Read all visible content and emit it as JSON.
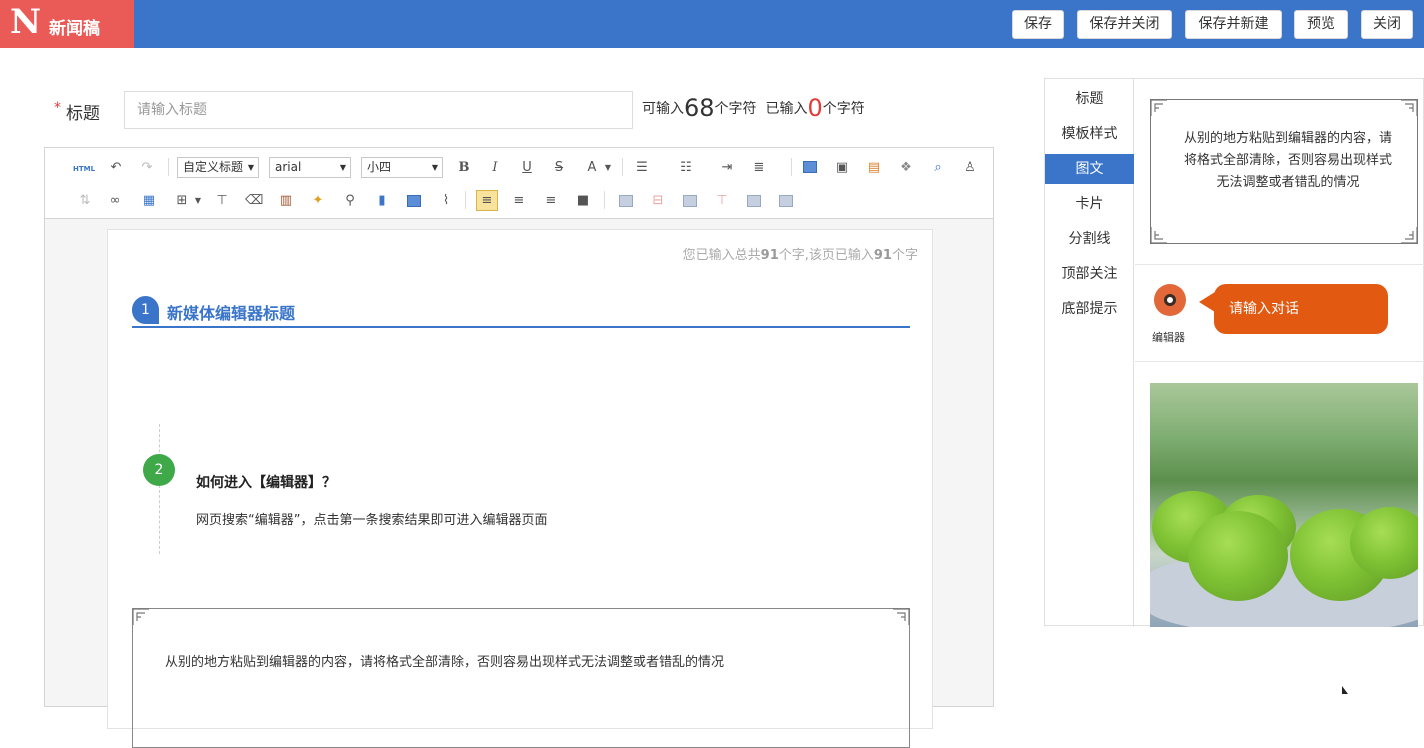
{
  "header": {
    "logo_letter": "N",
    "title": "新闻稿",
    "buttons": [
      "保存",
      "保存并关闭",
      "保存并新建",
      "预览",
      "关闭"
    ]
  },
  "title_row": {
    "required_mark": "*",
    "label": "标题",
    "placeholder": "请输入标题",
    "can_input_prefix": "可输入",
    "can_input_count": "68",
    "char_unit_1": "个字符",
    "entered_prefix": "已输入",
    "entered_count": "0",
    "char_unit_2": "个字符"
  },
  "toolbar": {
    "html_label": "HTML",
    "heading_select": "自定义标题",
    "font_select": "arial",
    "size_select": "小四",
    "bold": "B",
    "italic": "I",
    "underline": "U",
    "strike": "S",
    "font_color": "A"
  },
  "page": {
    "word_count_prefix": "您已输入总共",
    "total_count": "91",
    "word_count_mid": "个字,该页已输入",
    "page_count": "91",
    "word_count_suffix": "个字",
    "heading_number": "1",
    "heading_text": "新媒体编辑器标题",
    "step_number": "2",
    "question": "如何进入【编辑器】？",
    "answer": "网页搜索“编辑器”，点击第一条搜索结果即可进入编辑器页面",
    "frame_text": "从别的地方粘贴到编辑器的内容，请将格式全部清除，否则容易出现样式无法调整或者错乱的情况"
  },
  "right_panel": {
    "nav": [
      "标题",
      "模板样式",
      "图文",
      "卡片",
      "分割线",
      "顶部关注",
      "底部提示"
    ],
    "active_nav": "图文",
    "box_text": "从别的地方粘贴到编辑器的内容，请将格式全部清除，否则容易出现样式无法调整或者错乱的情况",
    "avatar_name": "编辑器",
    "bubble_text": "请输入对话"
  },
  "colors": {
    "header_bg": "#3a75c9",
    "logo_bg": "#ea5b57",
    "accent_red": "#e53935",
    "step_green": "#3fa94a",
    "bubble_orange": "#e25a12"
  }
}
